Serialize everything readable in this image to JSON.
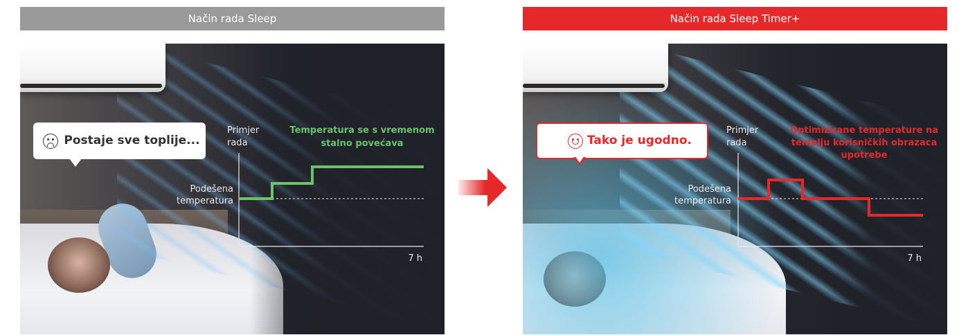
{
  "left": {
    "header": "Način rada Sleep",
    "header_color": "#9a9a9a",
    "bubble_text": "Postaje sve toplije...",
    "face": "sad-face-icon",
    "chart_caption_top": "Primjer",
    "chart_caption_bottom": "rada",
    "chart_title_line1": "Temperatura se s vremenom",
    "chart_title_line2": "stalno povećava",
    "set_temp_line1": "Podešena",
    "set_temp_line2": "temperatura",
    "x_end_label": "7 h",
    "line_color": "#6ac36b"
  },
  "right": {
    "header": "Način rada Sleep Timer+",
    "header_color": "#e5282a",
    "bubble_text": "Tako je ugodno.",
    "face": "happy-face-icon",
    "chart_caption_top": "Primjer",
    "chart_caption_bottom": "rada",
    "chart_title_line1": "Optimizirane temperature na",
    "chart_title_line2": "temelju korisničkih obrazaca",
    "chart_title_line3": "upotrebe",
    "set_temp_line1": "Podešena",
    "set_temp_line2": "temperatura",
    "x_end_label": "7 h",
    "line_color": "#e5282a"
  },
  "arrow_color": "#e5282a"
}
